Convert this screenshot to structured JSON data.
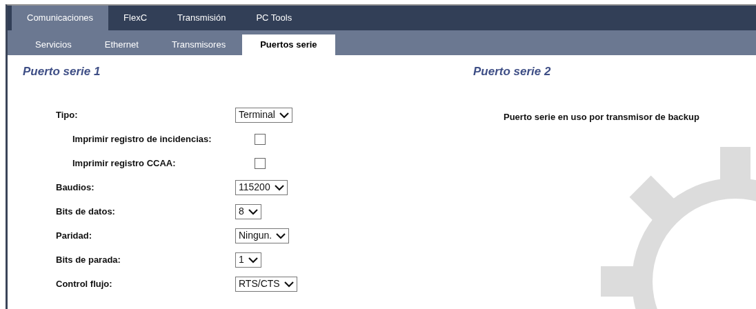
{
  "tabs": [
    {
      "label": "Comunicaciones",
      "selected": true
    },
    {
      "label": "FlexC",
      "selected": false
    },
    {
      "label": "Transmisión",
      "selected": false
    },
    {
      "label": "PC Tools",
      "selected": false
    }
  ],
  "subtabs": [
    {
      "label": "Servicios",
      "selected": false
    },
    {
      "label": "Ethernet",
      "selected": false
    },
    {
      "label": "Transmisores",
      "selected": false
    },
    {
      "label": "Puertos serie",
      "selected": true
    }
  ],
  "port1": {
    "title": "Puerto serie 1",
    "fields": [
      {
        "kind": "select",
        "label": "Tipo:",
        "value": "Terminal",
        "children": [
          {
            "kind": "checkbox",
            "label": "Imprimir registro de incidencias:",
            "checked": false
          },
          {
            "kind": "checkbox",
            "label": "Imprimir registro CCAA:",
            "checked": false
          }
        ]
      },
      {
        "kind": "select",
        "label": "Baudios:",
        "value": "115200"
      },
      {
        "kind": "select",
        "label": "Bits de datos:",
        "value": "8"
      },
      {
        "kind": "select",
        "label": "Paridad:",
        "value": "Ningun."
      },
      {
        "kind": "select",
        "label": "Bits de parada:",
        "value": "1"
      },
      {
        "kind": "select",
        "label": "Control flujo:",
        "value": "RTS/CTS"
      }
    ]
  },
  "port2": {
    "title": "Puerto serie 2",
    "message": "Puerto serie en uso por transmisor de backup"
  }
}
